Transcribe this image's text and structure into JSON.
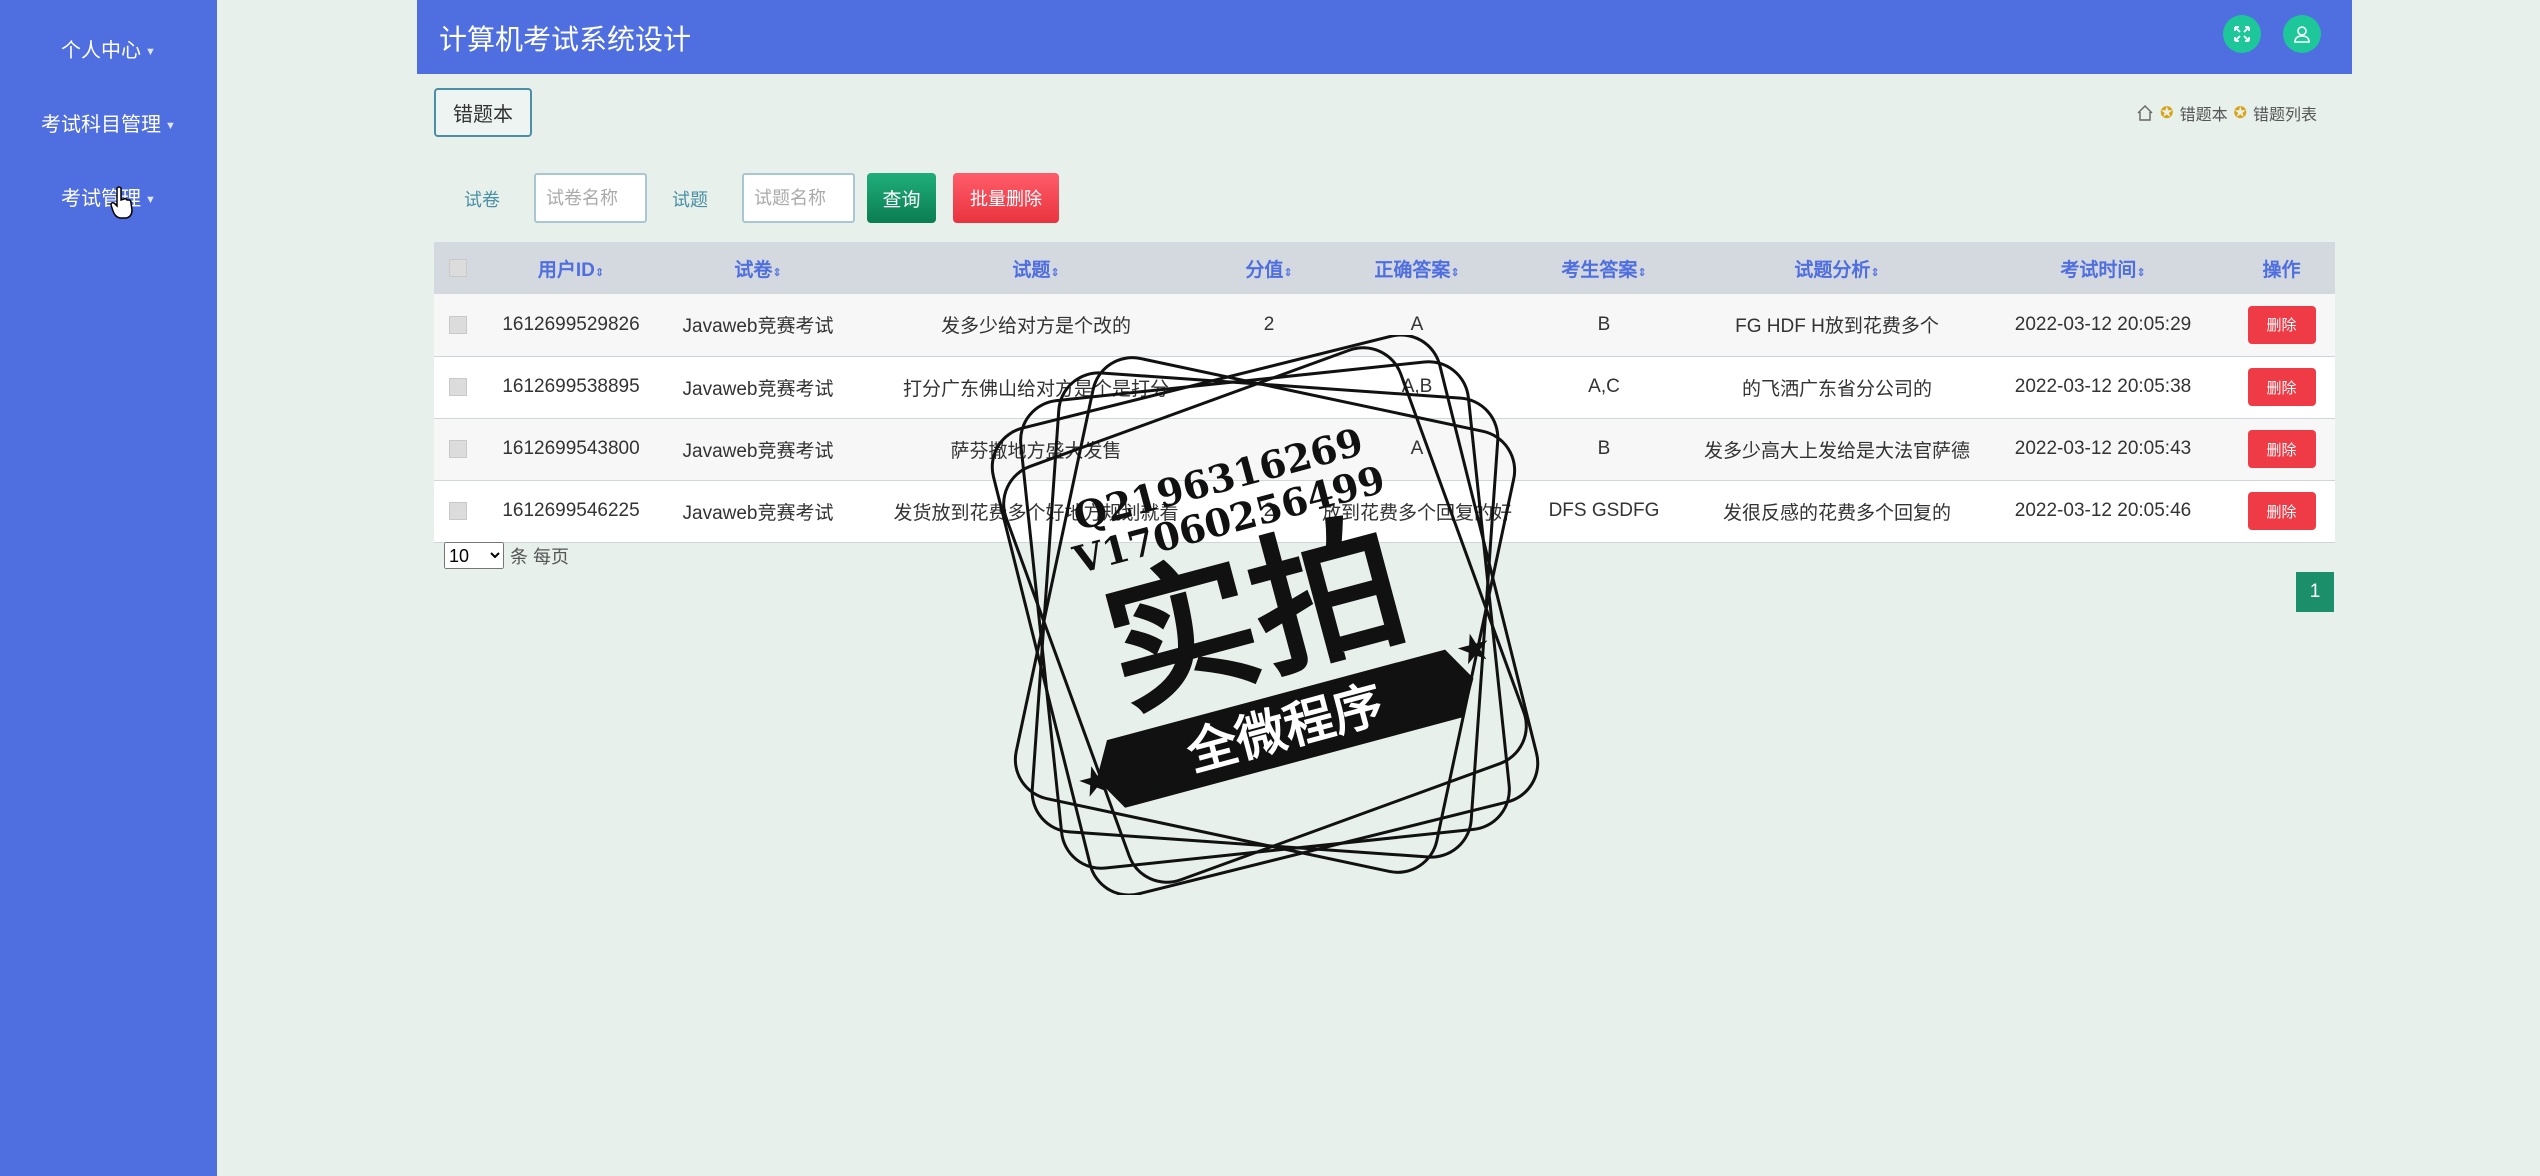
{
  "app": {
    "title": "计算机考试系统设计"
  },
  "sidebar": {
    "items": [
      {
        "label": "个人中心"
      },
      {
        "label": "考试科目管理"
      },
      {
        "label": "考试管理"
      }
    ]
  },
  "header": {
    "tab_label": "错题本"
  },
  "breadcrumb": {
    "items": [
      "错题本",
      "错题列表"
    ]
  },
  "search": {
    "paper_label": "试卷",
    "paper_placeholder": "试卷名称",
    "question_label": "试题",
    "question_placeholder": "试题名称",
    "query_label": "查询",
    "batch_delete_label": "批量删除"
  },
  "table": {
    "columns": [
      "用户ID",
      "试卷",
      "试题",
      "分值",
      "正确答案",
      "考生答案",
      "试题分析",
      "考试时间",
      "操作"
    ],
    "rows": [
      {
        "user_id": "1612699529826",
        "paper": "Javaweb竞赛考试",
        "question": "发多少给对方是个改的",
        "score": "2",
        "correct": "A",
        "answer": "B",
        "analysis": "FG HDF H放到花费多个",
        "time": "2022-03-12 20:05:29",
        "action": "删除"
      },
      {
        "user_id": "1612699538895",
        "paper": "Javaweb竞赛考试",
        "question": "打分广东佛山给对方是个是打分",
        "score": "",
        "correct": "A,B",
        "answer": "A,C",
        "analysis": "的飞洒广东省分公司的",
        "time": "2022-03-12 20:05:38",
        "action": "删除"
      },
      {
        "user_id": "1612699543800",
        "paper": "Javaweb竞赛考试",
        "question": "萨芬撒地方盛大发售",
        "score": "",
        "correct": "A",
        "answer": "B",
        "analysis": "发多少高大上发给是大法官萨德",
        "time": "2022-03-12 20:05:43",
        "action": "删除"
      },
      {
        "user_id": "1612699546225",
        "paper": "Javaweb竞赛考试",
        "question": "发货放到花费多个好地方规划就看",
        "score": "2",
        "correct": "放到花费多个回复的好",
        "answer": "DFS GSDFG",
        "analysis": "发很反感的花费多个回复的",
        "time": "2022-03-12 20:05:46",
        "action": "删除"
      }
    ]
  },
  "pagination": {
    "page_size": "10",
    "page_size_suffix": "条 每页",
    "current_page": "1"
  },
  "watermark": {
    "line1": "Q2196316269",
    "line2": "V17060256499",
    "big": "实拍",
    "banner": "全微程序"
  },
  "colors": {
    "primary": "#4f6ee0",
    "success": "#1a8f6a",
    "danger": "#ef3b45",
    "background": "#e8f0ec"
  }
}
